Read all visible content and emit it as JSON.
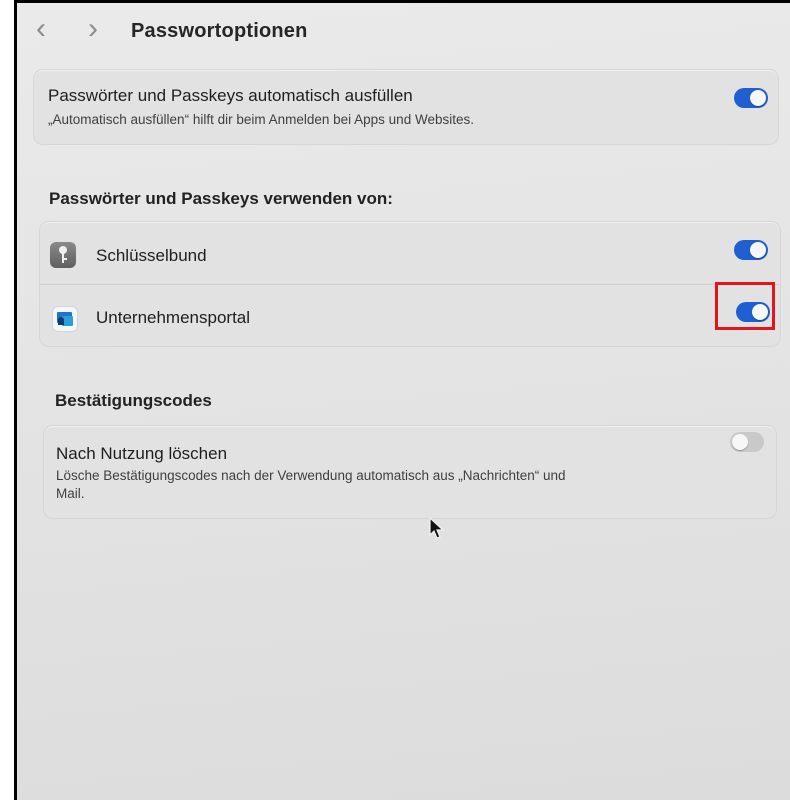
{
  "toolbar": {
    "back_glyph": "‹",
    "forward_glyph": "›",
    "title": "Passwortoptionen"
  },
  "autofill": {
    "title": "Passwörter und Passkeys automatisch ausfüllen",
    "subtitle": "„Automatisch ausfüllen“ hilft dir beim Anmelden bei Apps und Websites.",
    "enabled": true
  },
  "providers": {
    "heading": "Passwörter und Passkeys verwenden von:",
    "items": [
      {
        "label": "Schlüsselbund",
        "icon": "keychain-icon",
        "enabled": true
      },
      {
        "label": "Unternehmensportal",
        "icon": "company-portal-icon",
        "enabled": true
      }
    ]
  },
  "codes": {
    "heading": "Bestätigungscodes",
    "title": "Nach Nutzung löschen",
    "subtitle_line1": "Lösche Bestätigungscodes nach der Verwendung automatisch aus „Nachrichten“ und",
    "subtitle_line2": "Mail.",
    "enabled": false
  },
  "colors": {
    "toggle_on": "#1f5fcf",
    "toggle_off": "#c9c9c9",
    "highlight": "#e4141b"
  }
}
